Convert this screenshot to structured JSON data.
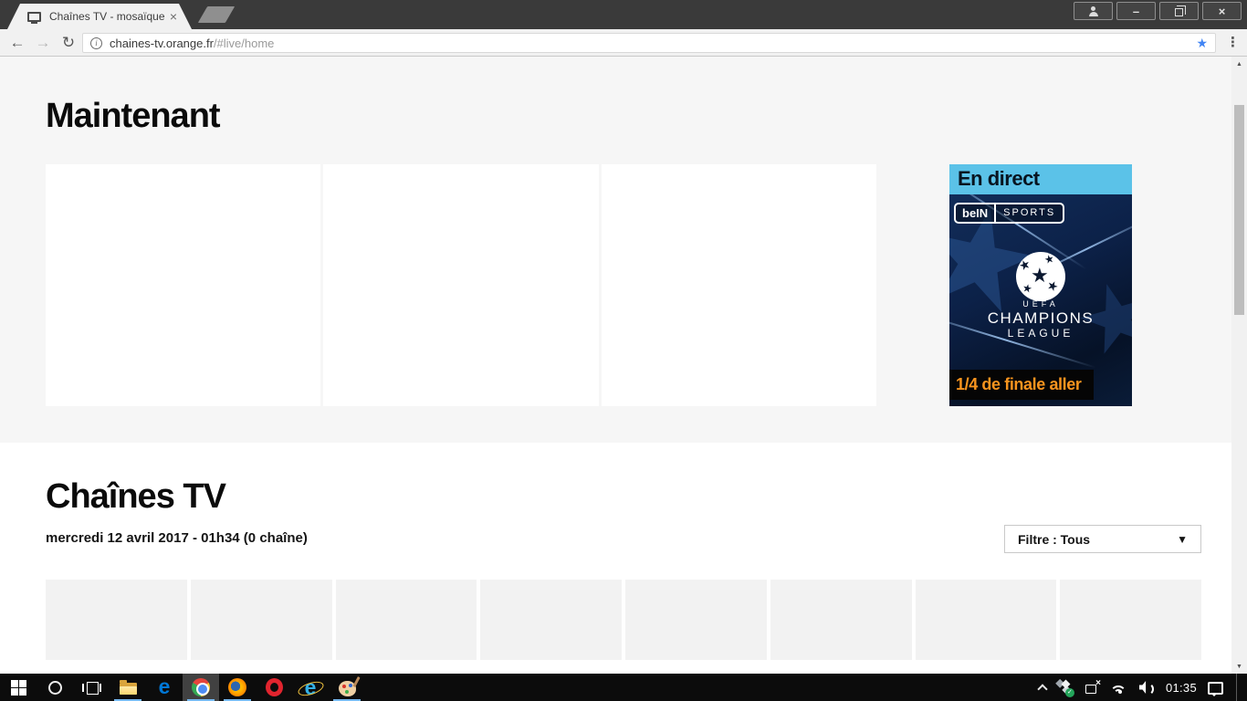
{
  "browser": {
    "tab": {
      "title": "Chaînes TV - mosaïque"
    },
    "address": {
      "host": "chaines-tv.orange.fr",
      "path": "/#live/home",
      "info_glyph": "i"
    },
    "icons": {
      "back": "←",
      "forward": "→",
      "reload": "↻",
      "menu": "⋮",
      "star": "★",
      "tab_close": "×",
      "minimize": "–",
      "close": "×",
      "scroll_up": "▲",
      "scroll_down": "▼"
    }
  },
  "page": {
    "now": {
      "title": "Maintenant",
      "card_count": 3
    },
    "channels": {
      "title": "Chaînes TV",
      "subtitle": "mercredi 12 avril 2017 - 01h34 (0 chaîne)",
      "filter": {
        "label": "Filtre : Tous",
        "caret": "▼"
      },
      "tile_count": 8
    },
    "colors": {
      "section_bg": "#f6f6f6",
      "tile_bg": "#f2f2f2"
    }
  },
  "ad": {
    "live_badge": "En direct",
    "bein": "beIN",
    "sports": "SPORTS",
    "star_glyph": "★",
    "uefa": "UEFA",
    "champions": "CHAMPIONS",
    "league": "LEAGUE",
    "footer": "1/4 de finale aller",
    "colors": {
      "badge_bg": "#5bc2e8",
      "footer_fg": "#f7941e",
      "bg": "#0c2148"
    }
  },
  "taskbar": {
    "clock": "01:35",
    "apps": [
      "start",
      "cortana-search",
      "task-view",
      "file-explorer",
      "edge",
      "chrome",
      "firefox",
      "opera",
      "internet-explorer",
      "paint"
    ],
    "indicator_color": "#76b9f0"
  }
}
